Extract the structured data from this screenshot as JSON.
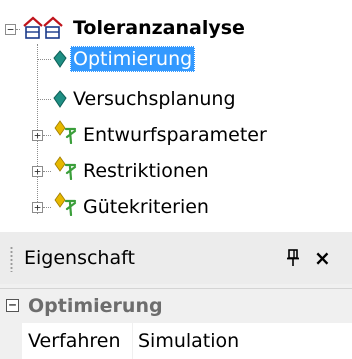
{
  "tree": {
    "root": {
      "label": "Toleranzanalyse",
      "icon": "assembly-icon",
      "expanded": true
    },
    "children": [
      {
        "label": "Optimierung",
        "icon": "diamond-node-icon",
        "selected": true
      },
      {
        "label": "Versuchsplanung",
        "icon": "diamond-node-icon",
        "selected": false
      },
      {
        "label": "Entwurfsparameter",
        "icon": "parameter-group-icon",
        "expandable": true
      },
      {
        "label": "Restriktionen",
        "icon": "parameter-group-icon",
        "expandable": true
      },
      {
        "label": "Gütekriterien",
        "icon": "parameter-group-icon",
        "expandable": true
      }
    ],
    "expand_glyph": "+",
    "collapse_glyph": "−"
  },
  "panel": {
    "title": "Eigenschaft",
    "pin_glyph": "🖈",
    "close_glyph": "×",
    "category": {
      "name": "Optimierung",
      "toggle_glyph": "−"
    },
    "properties": [
      {
        "name": "Verfahren",
        "value": "Simulation"
      }
    ]
  },
  "colors": {
    "selection": "#3399ff",
    "teal_icon": "#1f8f84",
    "red_icon": "#c0141c",
    "yellow_icon": "#e6b800",
    "green_icon": "#3a9e3a",
    "panel_bg": "#f0f0f0"
  }
}
